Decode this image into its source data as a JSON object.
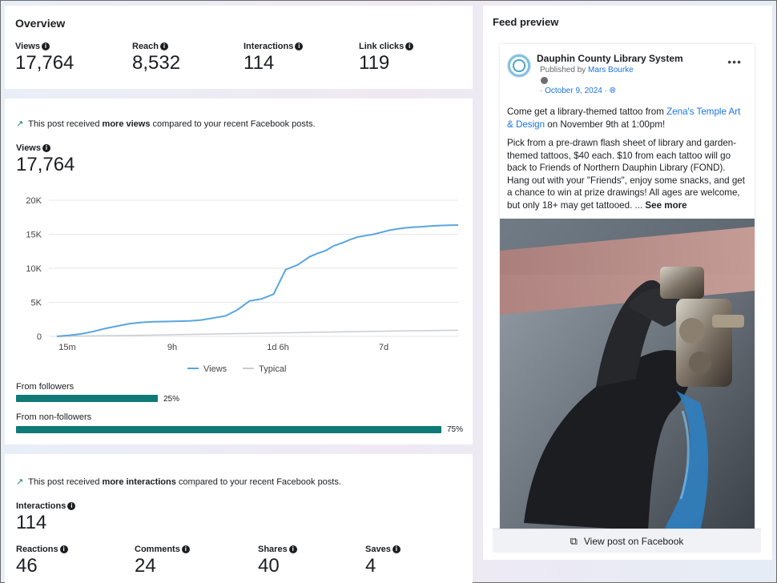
{
  "overview": {
    "title": "Overview",
    "metrics": [
      {
        "label": "Views",
        "value": "17,764"
      },
      {
        "label": "Reach",
        "value": "8,532"
      },
      {
        "label": "Interactions",
        "value": "114"
      },
      {
        "label": "Link clicks",
        "value": "119"
      }
    ]
  },
  "views_section": {
    "notice_prefix": "This post received ",
    "notice_bold": "more views",
    "notice_suffix": " compared to your recent Facebook posts.",
    "metric_label": "Views",
    "metric_value": "17,764",
    "legend_views": "Views",
    "legend_typical": "Typical",
    "followers_label": "From followers",
    "followers_pct": "25%",
    "followers_fraction": 0.25,
    "nonfollowers_label": "From non-followers",
    "nonfollowers_pct": "75%",
    "nonfollowers_fraction": 0.75
  },
  "chart_data": {
    "type": "line",
    "y_ticks": [
      "0",
      "5K",
      "10K",
      "15K",
      "20K"
    ],
    "x_ticks": [
      "15m",
      "9h",
      "1d 6h",
      "7d"
    ],
    "ylim": [
      0,
      20000
    ],
    "series": [
      {
        "name": "Views",
        "color": "#5aa5e0",
        "x": [
          0,
          0.03,
          0.06,
          0.09,
          0.12,
          0.15,
          0.18,
          0.21,
          0.24,
          0.27,
          0.3,
          0.33,
          0.36,
          0.39,
          0.42,
          0.45,
          0.48,
          0.51,
          0.54,
          0.57,
          0.6,
          0.63,
          0.65,
          0.67,
          0.69,
          0.71,
          0.73,
          0.75,
          0.77,
          0.79,
          0.81,
          0.83,
          0.85,
          0.87,
          0.89,
          0.91,
          0.93,
          0.96,
          1.0
        ],
        "values": [
          0,
          150,
          350,
          700,
          1150,
          1500,
          1850,
          2050,
          2150,
          2180,
          2220,
          2260,
          2400,
          2700,
          3000,
          3900,
          5200,
          5500,
          6200,
          9800,
          10500,
          11700,
          12200,
          12600,
          13300,
          13700,
          14200,
          14600,
          14800,
          15000,
          15300,
          15600,
          15800,
          15950,
          16050,
          16100,
          16200,
          16300,
          16350
        ]
      },
      {
        "name": "Typical",
        "color": "#c9ccd1",
        "x": [
          0,
          0.2,
          0.4,
          0.6,
          0.8,
          1.0
        ],
        "values": [
          0,
          150,
          350,
          550,
          750,
          900
        ]
      }
    ]
  },
  "interactions_section": {
    "notice_prefix": "This post received ",
    "notice_bold": "more interactions",
    "notice_suffix": " compared to your recent Facebook posts.",
    "metric_label": "Interactions",
    "metric_value": "114",
    "breakdown": [
      {
        "label": "Reactions",
        "value": "46"
      },
      {
        "label": "Comments",
        "value": "24"
      },
      {
        "label": "Shares",
        "value": "40"
      },
      {
        "label": "Saves",
        "value": "4"
      }
    ]
  },
  "feed_preview": {
    "title": "Feed preview",
    "page_name": "Dauphin County Library System",
    "published_prefix": "Published by ",
    "published_by": "Mars Bourke",
    "date": "· October 9, 2024 ·",
    "more_label": "•••",
    "text_line1_prefix": "Come get a library-themed tattoo from ",
    "text_line1_link": "Zena's Temple Art & Design",
    "text_line1_suffix": "  on November 9th at 1:00pm!",
    "body": "Pick from a pre-drawn flash sheet of library and garden-themed tattoos, $40 each. $10 from each tattoo will go back to Friends of Northern Dauphin Library (FOND). Hang out with your \"Friends\", enjoy some snacks, and get a chance to win at prize drawings!  All ages are welcome, but only 18+ may get tattooed. ... ",
    "see_more": "See more",
    "view_on_facebook": "View post on Facebook"
  },
  "icons": {
    "info": "info-icon",
    "trend": "trend-up-icon",
    "globe": "globe-icon",
    "external": "external-link-icon"
  }
}
